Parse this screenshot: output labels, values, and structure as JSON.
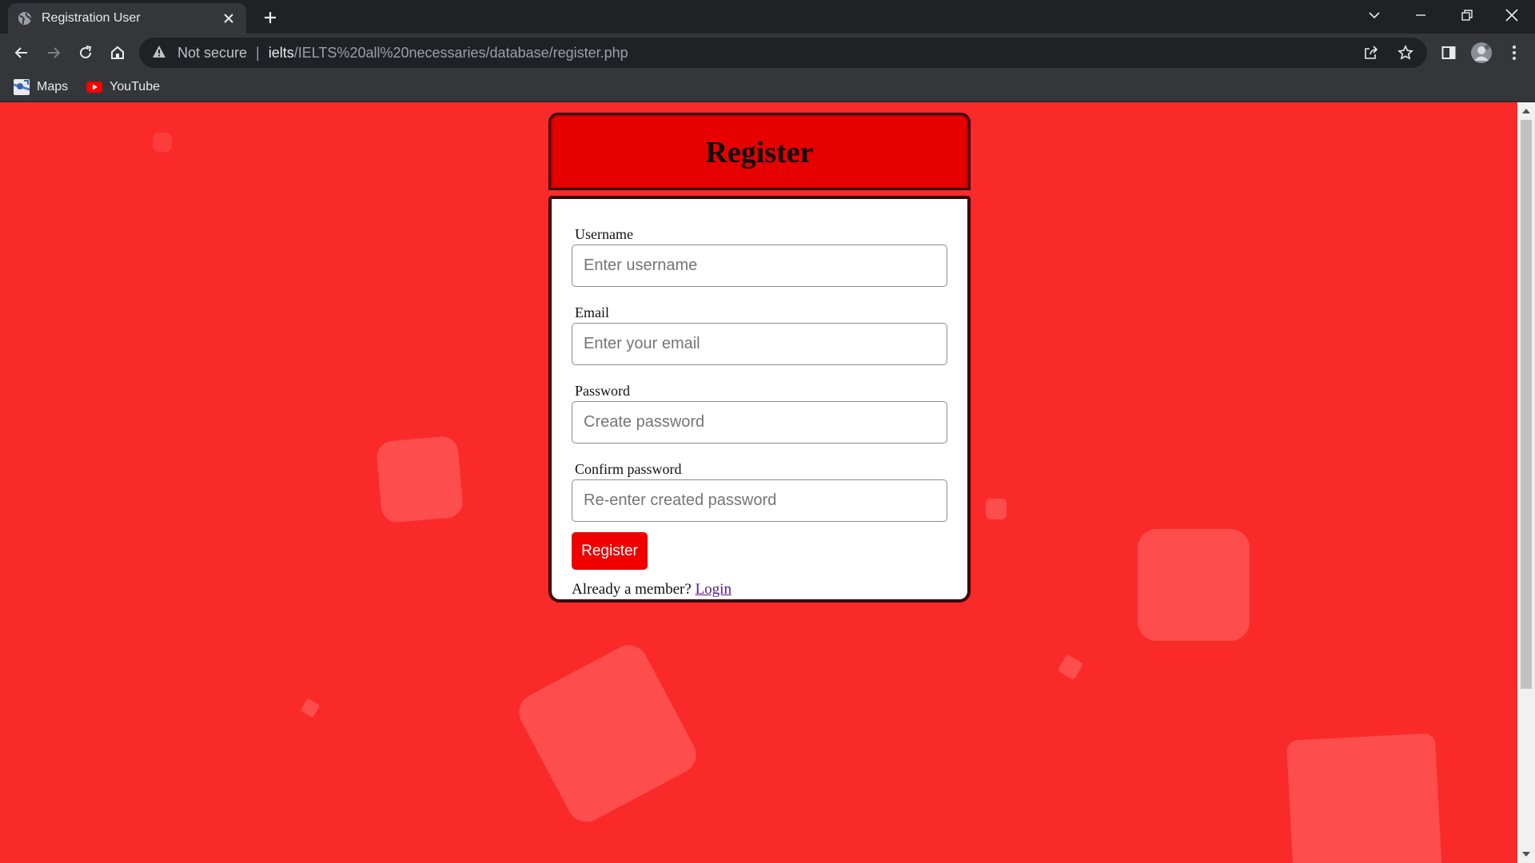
{
  "browser": {
    "tab_title": "Registration User",
    "address": {
      "security_label": "Not secure",
      "separator": "|",
      "host": "ielts",
      "path": "/IELTS%20all%20necessaries/database/register.php"
    },
    "bookmarks": [
      {
        "label": "Maps",
        "icon": "maps-icon"
      },
      {
        "label": "YouTube",
        "icon": "youtube-icon"
      }
    ]
  },
  "form": {
    "title": "Register",
    "fields": [
      {
        "label": "Username",
        "placeholder": "Enter username",
        "value": ""
      },
      {
        "label": "Email",
        "placeholder": "Enter your email",
        "value": ""
      },
      {
        "label": "Password",
        "placeholder": "Create password",
        "value": ""
      },
      {
        "label": "Confirm password",
        "placeholder": "Re-enter created password",
        "value": ""
      }
    ],
    "submit_label": "Register",
    "member_prompt": "Already a member?",
    "login_link": "Login"
  },
  "colors": {
    "page_background": "#fa2a2a",
    "header_background": "#e60000",
    "button_background": "#f00000",
    "chrome_dark": "#202124",
    "chrome_toolbar": "#35363a"
  }
}
